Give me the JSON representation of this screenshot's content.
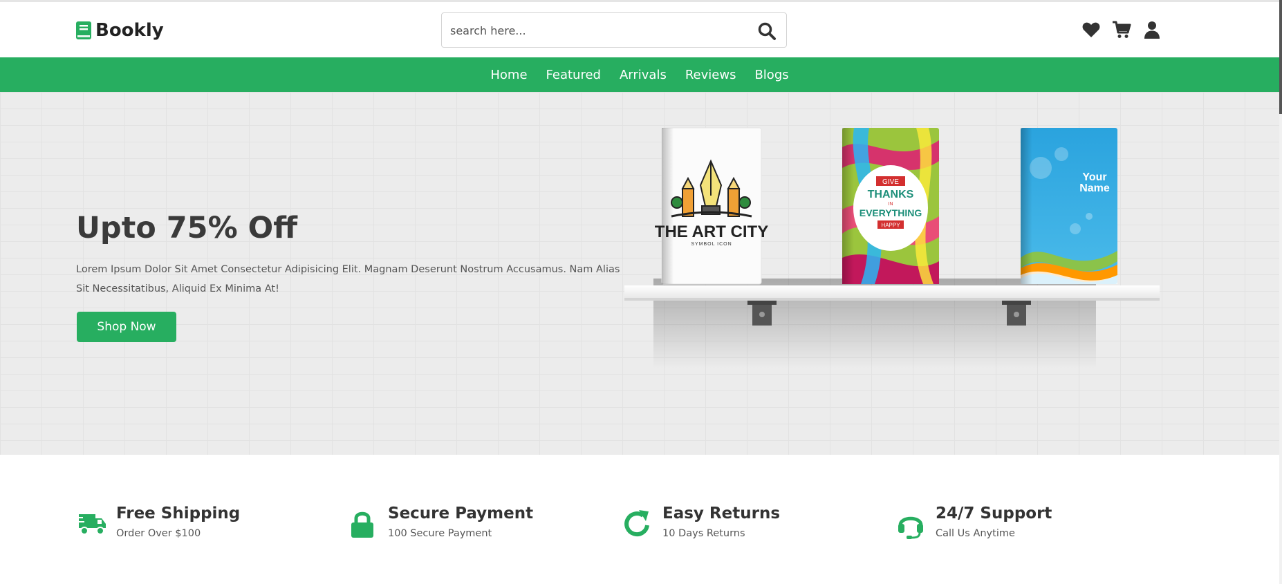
{
  "brand": {
    "name": "Bookly",
    "accent": "#27ae60"
  },
  "search": {
    "placeholder": "search here..."
  },
  "header_icons": [
    "heart-icon",
    "cart-icon",
    "user-icon"
  ],
  "nav": {
    "items": [
      "Home",
      "Featured",
      "Arrivals",
      "Reviews",
      "Blogs"
    ]
  },
  "hero": {
    "title": "Upto 75% Off",
    "text": "Lorem Ipsum Dolor Sit Amet Consectetur Adipisicing Elit. Magnam Deserunt Nostrum Accusamus. Nam Alias Sit Necessitatibus, Aliquid Ex Minima At!",
    "button": "Shop Now",
    "books": [
      {
        "line1": "THE ART CITY",
        "line2": "SYMBOL ICON"
      },
      {
        "line1": "GIVE",
        "line2": "THANKS",
        "line3": "IN",
        "line4": "EVERYTHING",
        "line5": "HAPPY"
      },
      {
        "line1": "Your",
        "line2": "Name"
      }
    ]
  },
  "features": [
    {
      "icon": "truck-icon",
      "title": "Free Shipping",
      "subtitle": "Order Over $100"
    },
    {
      "icon": "lock-icon",
      "title": "Secure Payment",
      "subtitle": "100 Secure Payment"
    },
    {
      "icon": "redo-icon",
      "title": "Easy Returns",
      "subtitle": "10 Days Returns"
    },
    {
      "icon": "headset-icon",
      "title": "24/7 Support",
      "subtitle": "Call Us Anytime"
    }
  ]
}
